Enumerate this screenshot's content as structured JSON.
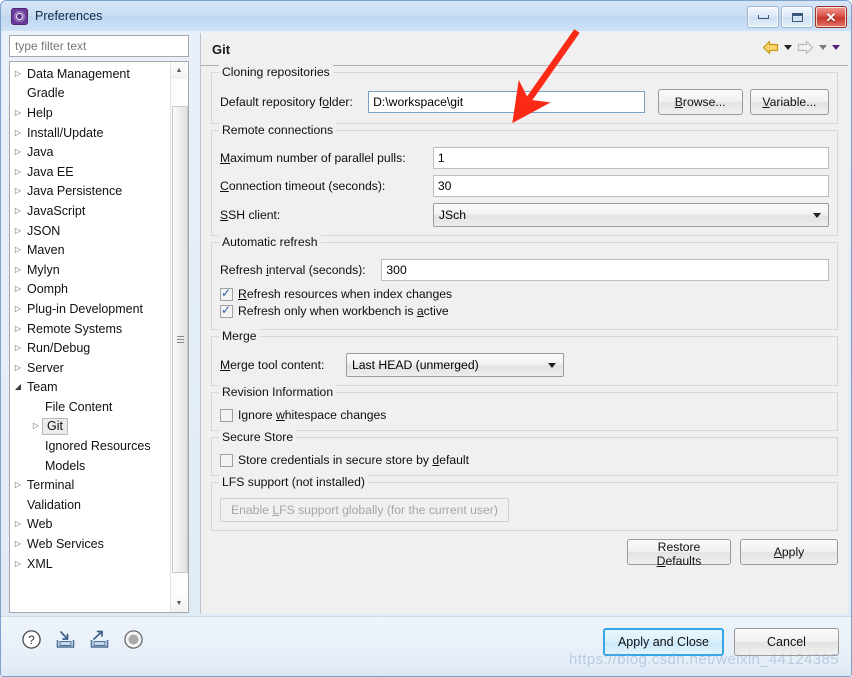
{
  "window": {
    "title": "Preferences",
    "icon": "preferences-gear-icon",
    "minimize_label": "Minimize",
    "maximize_label": "Maximize",
    "close_label": "Close"
  },
  "sidebar": {
    "filter_placeholder": "type filter text",
    "filter_value": "",
    "items": [
      {
        "label": "Data Management",
        "level": 1,
        "expander": "collapsed"
      },
      {
        "label": "Gradle",
        "level": 1,
        "expander": "none"
      },
      {
        "label": "Help",
        "level": 1,
        "expander": "collapsed"
      },
      {
        "label": "Install/Update",
        "level": 1,
        "expander": "collapsed"
      },
      {
        "label": "Java",
        "level": 1,
        "expander": "collapsed"
      },
      {
        "label": "Java EE",
        "level": 1,
        "expander": "collapsed"
      },
      {
        "label": "Java Persistence",
        "level": 1,
        "expander": "collapsed"
      },
      {
        "label": "JavaScript",
        "level": 1,
        "expander": "collapsed"
      },
      {
        "label": "JSON",
        "level": 1,
        "expander": "collapsed"
      },
      {
        "label": "Maven",
        "level": 1,
        "expander": "collapsed"
      },
      {
        "label": "Mylyn",
        "level": 1,
        "expander": "collapsed"
      },
      {
        "label": "Oomph",
        "level": 1,
        "expander": "collapsed"
      },
      {
        "label": "Plug-in Development",
        "level": 1,
        "expander": "collapsed"
      },
      {
        "label": "Remote Systems",
        "level": 1,
        "expander": "collapsed"
      },
      {
        "label": "Run/Debug",
        "level": 1,
        "expander": "collapsed"
      },
      {
        "label": "Server",
        "level": 1,
        "expander": "collapsed"
      },
      {
        "label": "Team",
        "level": 1,
        "expander": "expanded"
      },
      {
        "label": "File Content",
        "level": 2,
        "expander": "none"
      },
      {
        "label": "Git",
        "level": 2,
        "expander": "collapsed",
        "selected": true
      },
      {
        "label": "Ignored Resources",
        "level": 2,
        "expander": "none"
      },
      {
        "label": "Models",
        "level": 2,
        "expander": "none"
      },
      {
        "label": "Terminal",
        "level": 1,
        "expander": "collapsed"
      },
      {
        "label": "Validation",
        "level": 1,
        "expander": "none"
      },
      {
        "label": "Web",
        "level": 1,
        "expander": "collapsed"
      },
      {
        "label": "Web Services",
        "level": 1,
        "expander": "collapsed"
      },
      {
        "label": "XML",
        "level": 1,
        "expander": "collapsed"
      }
    ]
  },
  "page": {
    "title": "Git",
    "nav": {
      "back_icon": "back-arrow-icon",
      "back_menu_icon": "chevron-down-icon",
      "forward_icon": "forward-arrow-icon",
      "forward_menu_icon": "chevron-down-icon",
      "view_menu_icon": "chevron-down-icon"
    },
    "groups": {
      "cloning": {
        "title": "Cloning repositories",
        "default_repo_label_pre": "Default repository f",
        "default_repo_label_accel": "o",
        "default_repo_label_post": "lder:",
        "default_repo_value": "D:\\workspace\\git",
        "browse_label_pre": "",
        "browse_label_accel": "B",
        "browse_label_post": "rowse...",
        "variable_label_accel": "V",
        "variable_label_post": "ariable..."
      },
      "remote": {
        "title": "Remote connections",
        "max_pulls_accel": "M",
        "max_pulls_label_post": "aximum number of parallel pulls:",
        "max_pulls_value": "1",
        "timeout_accel": "C",
        "timeout_label_post": "onnection timeout (seconds):",
        "timeout_value": "30",
        "ssh_accel": "S",
        "ssh_label_post": "SH client:",
        "ssh_value": "JSch"
      },
      "refresh": {
        "title": "Automatic refresh",
        "interval_label_pre": "Refresh ",
        "interval_accel": "i",
        "interval_label_post": "nterval (seconds):",
        "interval_value": "300",
        "check1_pre": "",
        "check1_accel": "R",
        "check1_post": "efresh resources when index changes",
        "check1_checked": true,
        "check2_pre": "Refresh only when workbench is ",
        "check2_accel": "a",
        "check2_post": "ctive",
        "check2_checked": true
      },
      "merge": {
        "title": "Merge",
        "tool_accel": "M",
        "tool_label_post": "erge tool content:",
        "tool_value": "Last HEAD (unmerged)"
      },
      "revision": {
        "title": "Revision Information",
        "check_pre": "Ignore ",
        "check_accel": "w",
        "check_post": "hitespace changes",
        "check_checked": false
      },
      "secure": {
        "title": "Secure Store",
        "check_pre": "Store credentials in secure store by ",
        "check_accel": "d",
        "check_post": "efault",
        "check_checked": false
      },
      "lfs": {
        "title": "LFS support (not installed)",
        "button_pre": "Enable ",
        "button_accel": "L",
        "button_post": "FS support globally (for the current user)",
        "button_disabled": true
      }
    },
    "restore_defaults_pre": "Restore ",
    "restore_defaults_accel": "D",
    "restore_defaults_post": "efaults",
    "apply_accel": "A",
    "apply_post": "pply"
  },
  "footer": {
    "help_icon": "help-question-icon",
    "import_icon": "import-icon",
    "export_icon": "export-icon",
    "status_icon": "status-circle-icon",
    "apply_and_close_label": "Apply and Close",
    "cancel_label": "Cancel"
  },
  "annotation": {
    "arrow_color": "#fb2a17",
    "arrow_name": "red-pointer-arrow"
  },
  "watermark": {
    "text": "https://blog.csdn.net/weixin_44124385"
  },
  "colors": {
    "accent_blue": "#35a7e6",
    "title_bar": "#c9ddf2",
    "group_border": "#d6d6d6",
    "page_bg": "#f0f0f0"
  }
}
